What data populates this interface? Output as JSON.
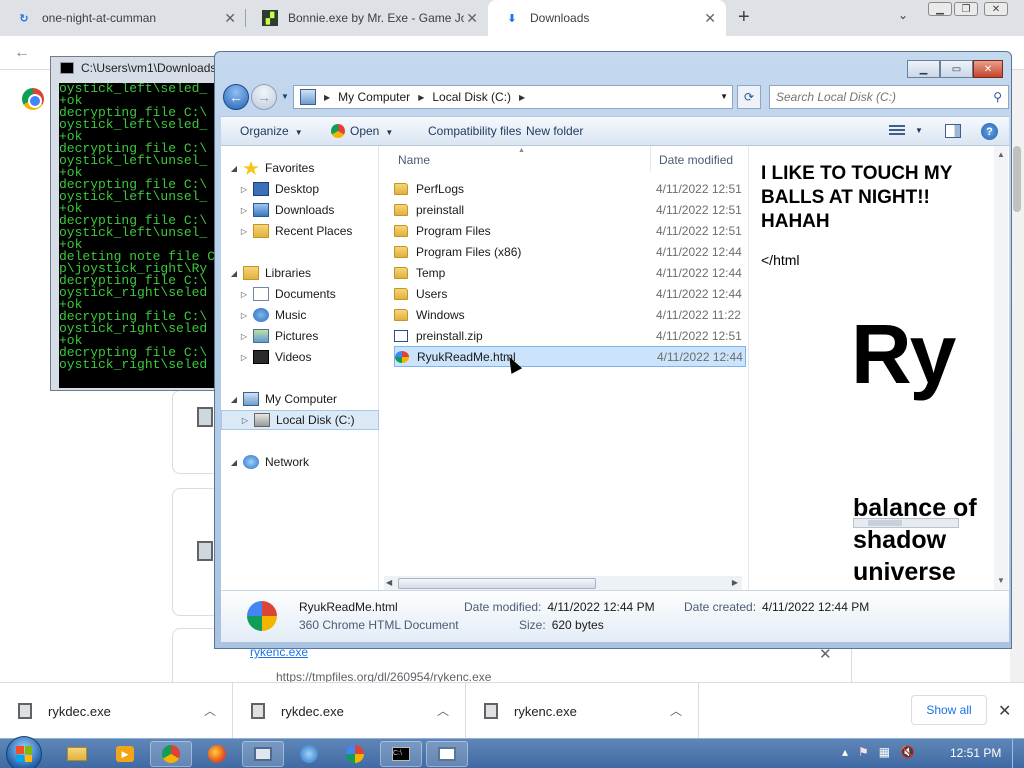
{
  "browser": {
    "tabs": [
      {
        "label": "one-night-at-cumman",
        "icon": "link-icon"
      },
      {
        "label": "Bonnie.exe by Mr. Exe - Game Jo",
        "icon": "gamejolt-icon"
      },
      {
        "label": "Downloads",
        "icon": "download-icon"
      }
    ],
    "new_tab_symbol": "+",
    "downloads_page": {
      "item_name": "rykenc.exe",
      "item_url": "https://tmpfiles.org/dl/260954/rykenc.exe"
    },
    "shelf": {
      "items": [
        {
          "name": "rykdec.exe"
        },
        {
          "name": "rykdec.exe"
        },
        {
          "name": "rykenc.exe"
        }
      ],
      "show_all": "Show all"
    }
  },
  "cmd": {
    "title": "C:\\Users\\vm1\\Downloads",
    "lines": [
      "oystick_left\\seled_",
      "+ok",
      "decrypting file C:\\",
      "oystick_left\\seled_",
      "+ok",
      "decrypting file C:\\",
      "oystick_left\\unsel_",
      "+ok",
      "decrypting file C:\\",
      "oystick_left\\unsel_",
      "+ok",
      "decrypting file C:\\",
      "oystick_left\\unsel_",
      "+ok",
      "deleting note file C",
      "p\\joystick_right\\Ry",
      "decrypting file C:\\",
      "oystick_right\\seled",
      "+ok",
      "decrypting file C:\\",
      "oystick_right\\seled",
      "+ok",
      "decrypting file C:\\",
      "oystick_right\\seled"
    ]
  },
  "explorer": {
    "address": [
      "My Computer",
      "Local Disk (C:)"
    ],
    "search_placeholder": "Search Local Disk (C:)",
    "commands": {
      "organize": "Organize",
      "open": "Open",
      "compat": "Compatibility files",
      "new_folder": "New folder"
    },
    "nav": [
      {
        "label": "Favorites",
        "level": 0,
        "icon": "star-icon"
      },
      {
        "label": "Desktop",
        "level": 1,
        "icon": "desktop-icon"
      },
      {
        "label": "Downloads",
        "level": 1,
        "icon": "downloads-folder-icon"
      },
      {
        "label": "Recent Places",
        "level": 1,
        "icon": "recent-places-icon"
      },
      {
        "label": "Libraries",
        "level": 0,
        "icon": "libraries-icon"
      },
      {
        "label": "Documents",
        "level": 1,
        "icon": "documents-icon"
      },
      {
        "label": "Music",
        "level": 1,
        "icon": "music-icon"
      },
      {
        "label": "Pictures",
        "level": 1,
        "icon": "pictures-icon"
      },
      {
        "label": "Videos",
        "level": 1,
        "icon": "videos-icon"
      },
      {
        "label": "My Computer",
        "level": 0,
        "icon": "computer-icon"
      },
      {
        "label": "Local Disk (C:)",
        "level": 1,
        "icon": "disk-icon"
      },
      {
        "label": "Network",
        "level": 0,
        "icon": "network-icon"
      }
    ],
    "columns": {
      "name": "Name",
      "date": "Date modified"
    },
    "files": [
      {
        "name": "PerfLogs",
        "date": "4/11/2022 12:51",
        "type": "folder"
      },
      {
        "name": "preinstall",
        "date": "4/11/2022 12:51",
        "type": "folder"
      },
      {
        "name": "Program Files",
        "date": "4/11/2022 12:51",
        "type": "folder"
      },
      {
        "name": "Program Files (x86)",
        "date": "4/11/2022 12:44",
        "type": "folder"
      },
      {
        "name": "Temp",
        "date": "4/11/2022 12:44",
        "type": "folder"
      },
      {
        "name": "Users",
        "date": "4/11/2022 12:44",
        "type": "folder"
      },
      {
        "name": "Windows",
        "date": "4/11/2022 11:22 .",
        "type": "folder"
      },
      {
        "name": "preinstall.zip",
        "date": "4/11/2022 12:51",
        "type": "zip"
      },
      {
        "name": "RyukReadMe.html",
        "date": "4/11/2022 12:44",
        "type": "html"
      }
    ],
    "preview": {
      "headline": "I LIKE TO TOUCH MY BALLS AT NIGHT!! HAHAH",
      "tag": "</html",
      "big": "Ry",
      "bottom": "balance of shadow universe"
    },
    "details": {
      "name": "RyukReadMe.html",
      "type": "360 Chrome HTML Document",
      "modified_label": "Date modified:",
      "modified_value": "4/11/2022 12:44 PM",
      "created_label": "Date created:",
      "created_value": "4/11/2022 12:44 PM",
      "size_label": "Size:",
      "size_value": "620 bytes"
    }
  },
  "taskbar": {
    "clock": "12:51 PM"
  }
}
